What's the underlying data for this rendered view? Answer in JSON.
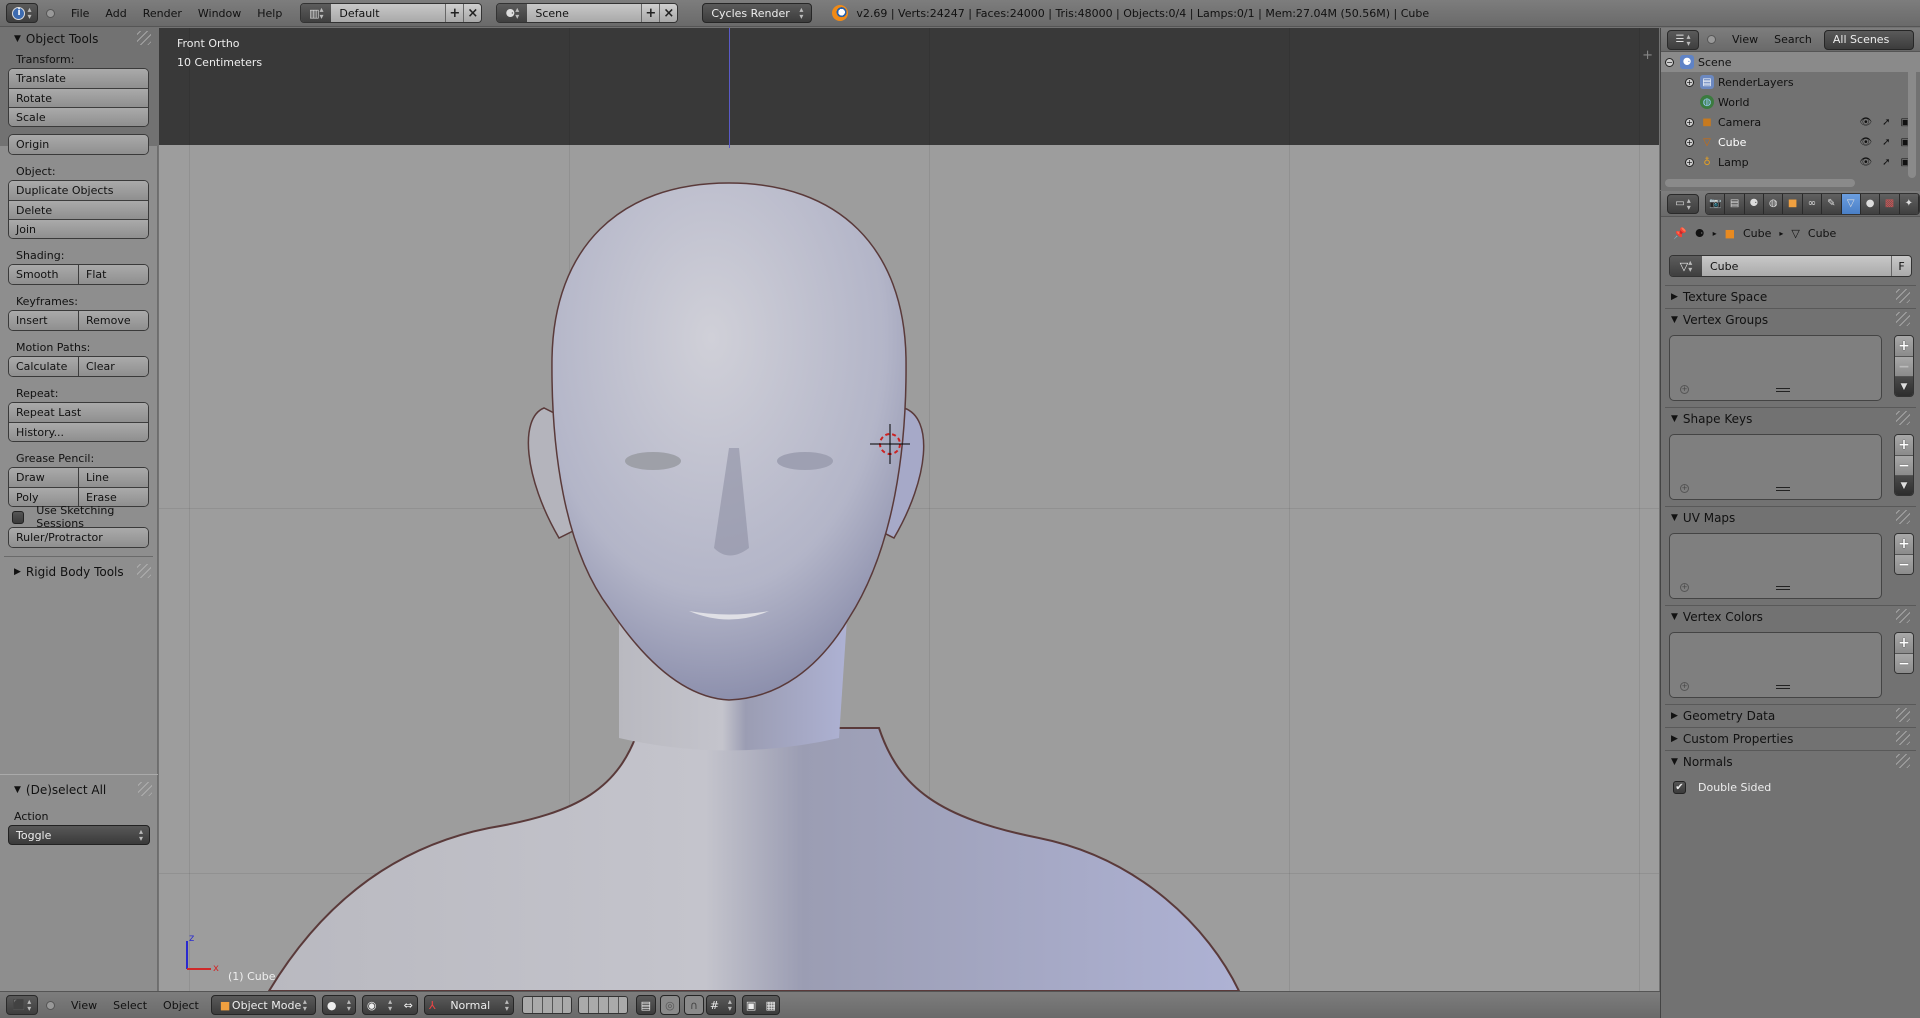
{
  "topbar": {
    "menus": [
      "File",
      "Add",
      "Render",
      "Window",
      "Help"
    ],
    "screen_layout": "Default",
    "scene": "Scene",
    "render_engine": "Cycles Render",
    "info": "v2.69 | Verts:24247 | Faces:24000 | Tris:48000 | Objects:0/4 | Lamps:0/1 | Mem:27.04M (50.56M) | Cube"
  },
  "toolshelf": {
    "title": "Object Tools",
    "transform_label": "Transform:",
    "translate": "Translate",
    "rotate": "Rotate",
    "scale": "Scale",
    "origin": "Origin",
    "object_label": "Object:",
    "duplicate": "Duplicate Objects",
    "delete": "Delete",
    "join": "Join",
    "shading_label": "Shading:",
    "smooth": "Smooth",
    "flat": "Flat",
    "keyframes_label": "Keyframes:",
    "insert": "Insert",
    "remove": "Remove",
    "motion_paths_label": "Motion Paths:",
    "calculate": "Calculate",
    "clear": "Clear",
    "repeat_label": "Repeat:",
    "repeat_last": "Repeat Last",
    "history": "History...",
    "grease_pencil_label": "Grease Pencil:",
    "draw": "Draw",
    "line": "Line",
    "poly": "Poly",
    "erase": "Erase",
    "use_sketching": "Use Sketching Sessions",
    "use_sketching_checked": false,
    "ruler": "Ruler/Protractor",
    "rigid_body": "Rigid Body Tools"
  },
  "operator": {
    "title": "(De)select All",
    "action_label": "Action",
    "action_value": "Toggle"
  },
  "viewport": {
    "view_name": "Front Ortho",
    "grid_scale": "10 Centimeters",
    "status": "(1) Cube",
    "axis_z": "z",
    "axis_x": "x"
  },
  "bottombar": {
    "menus": [
      "View",
      "Select",
      "Object"
    ],
    "mode": "Object Mode",
    "orientation": "Normal"
  },
  "outliner": {
    "menus": [
      "View",
      "Search"
    ],
    "filter": "All Scenes",
    "items": [
      {
        "name": "Scene",
        "icon": "scene-icon"
      },
      {
        "name": "RenderLayers",
        "icon": "render-layers-icon"
      },
      {
        "name": "World",
        "icon": "world-icon"
      },
      {
        "name": "Camera",
        "icon": "camera-icon"
      },
      {
        "name": "Cube",
        "icon": "mesh-icon"
      },
      {
        "name": "Lamp",
        "icon": "lamp-icon"
      }
    ]
  },
  "properties": {
    "breadcrumb": [
      "Cube",
      "Cube"
    ],
    "mesh_name": "Cube",
    "fake_user": "F",
    "panels": {
      "texture_space": "Texture Space",
      "vertex_groups": "Vertex Groups",
      "shape_keys": "Shape Keys",
      "uv_maps": "UV Maps",
      "vertex_colors": "Vertex Colors",
      "geometry_data": "Geometry Data",
      "custom_properties": "Custom Properties",
      "normals": "Normals"
    },
    "double_sided": "Double Sided",
    "double_sided_checked": true
  }
}
